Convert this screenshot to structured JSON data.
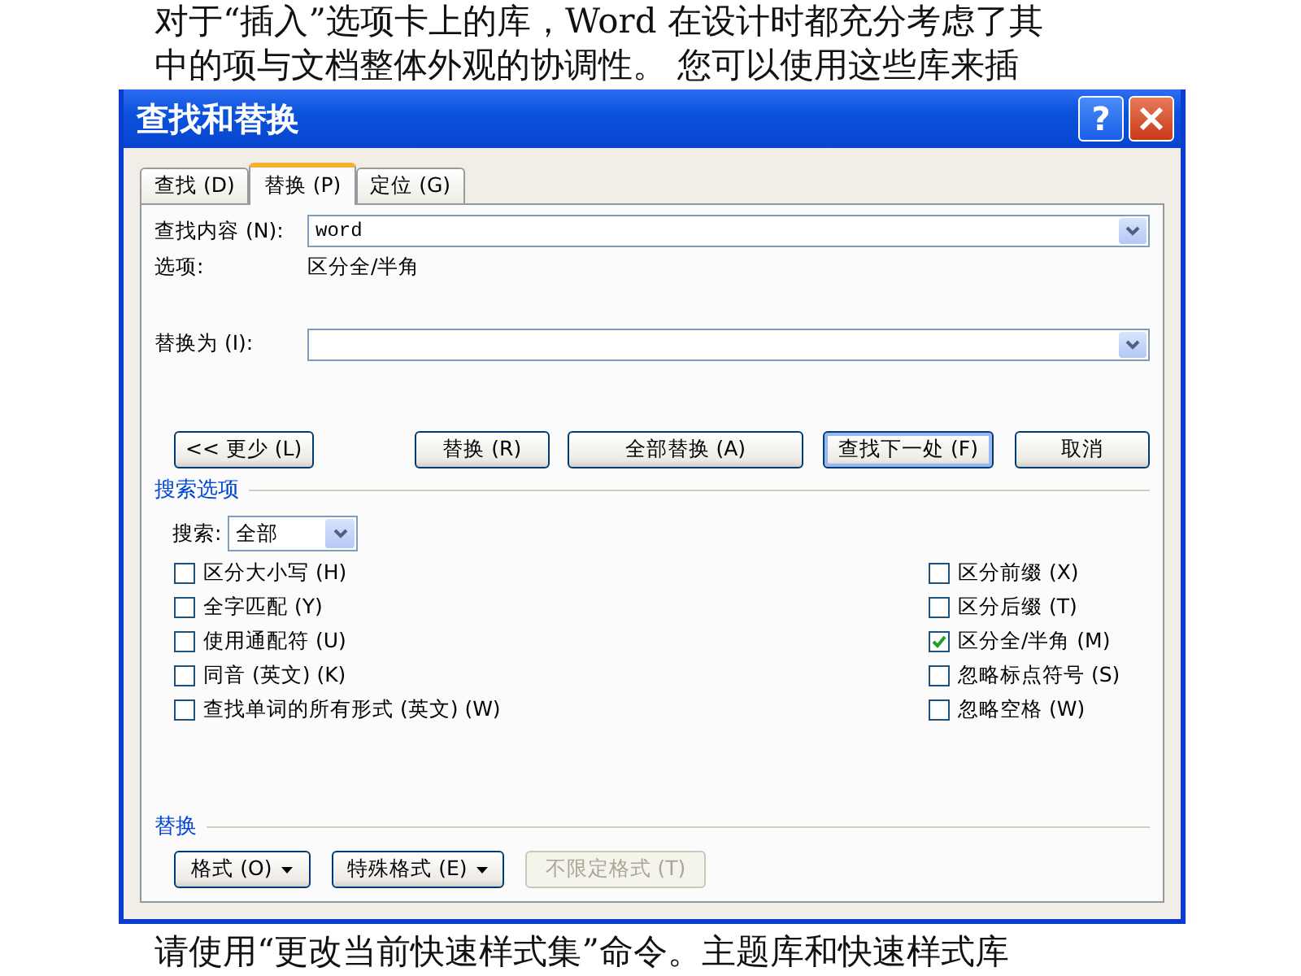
{
  "document": {
    "lines": [
      "对于“插入”选项卡上的库，Word 在设计时都充分考虑了其",
      "中的项与文档整体外观的协调性。 您可以使用这些库来插",
      "请使用“更改当前快速样式集”命令。主题库和快速样式库"
    ]
  },
  "dialog": {
    "title": "查找和替换",
    "help_button": "?",
    "tabs": [
      {
        "label": "查找 (D)",
        "selected": false
      },
      {
        "label": "替换 (P)",
        "selected": true
      },
      {
        "label": "定位 (G)",
        "selected": false
      }
    ],
    "find_what": {
      "label": "查找内容 (N):",
      "value": "word"
    },
    "options": {
      "label": "选项:",
      "value": "区分全/半角"
    },
    "replace_with": {
      "label": "替换为 (I):"
    },
    "buttons": [
      {
        "label": "<< 更少 (L)",
        "default": false
      },
      {
        "label": "替换 (R)",
        "default": false
      },
      {
        "label": "全部替换 (A)",
        "default": false
      },
      {
        "label": "查找下一处 (F)",
        "default": true
      },
      {
        "label": "取消",
        "default": false
      }
    ],
    "search_options": {
      "heading": "搜索选项",
      "search": {
        "label": "搜索:",
        "value": "全部"
      },
      "left": [
        {
          "label": "区分大小写 (H)",
          "checked": false
        },
        {
          "label": "全字匹配 (Y)",
          "checked": false
        },
        {
          "label": "使用通配符 (U)",
          "checked": false
        },
        {
          "label": "同音 (英文) (K)",
          "checked": false
        },
        {
          "label": "查找单词的所有形式 (英文) (W)",
          "checked": false
        }
      ],
      "right": [
        {
          "label": "区分前缀 (X)",
          "checked": false
        },
        {
          "label": "区分后缀 (T)",
          "checked": false
        },
        {
          "label": "区分全/半角 (M)",
          "checked": true
        },
        {
          "label": "忽略标点符号 (S)",
          "checked": false
        },
        {
          "label": "忽略空格 (W)",
          "checked": false
        }
      ]
    },
    "replace_section": {
      "heading": "替换",
      "buttons": [
        {
          "label": "格式 (O)",
          "dropdown": true,
          "disabled": false
        },
        {
          "label": "特殊格式 (E)",
          "dropdown": true,
          "disabled": false
        },
        {
          "label": "不限定格式 (T)",
          "dropdown": false,
          "disabled": true
        }
      ]
    }
  }
}
